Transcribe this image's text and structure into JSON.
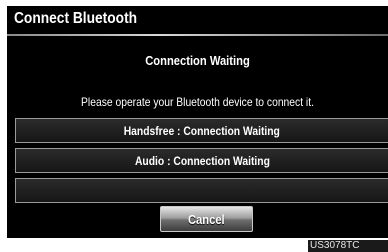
{
  "window": {
    "title": "Connect Bluetooth"
  },
  "status": {
    "heading": "Connection Waiting",
    "message": "Please operate your Bluetooth device to connect it."
  },
  "connections": [
    {
      "label": "Handsfree : Connection Waiting"
    },
    {
      "label": "Audio : Connection Waiting"
    },
    {
      "label": ""
    }
  ],
  "buttons": {
    "cancel_label": "Cancel"
  },
  "figure_code": "US3078TC"
}
